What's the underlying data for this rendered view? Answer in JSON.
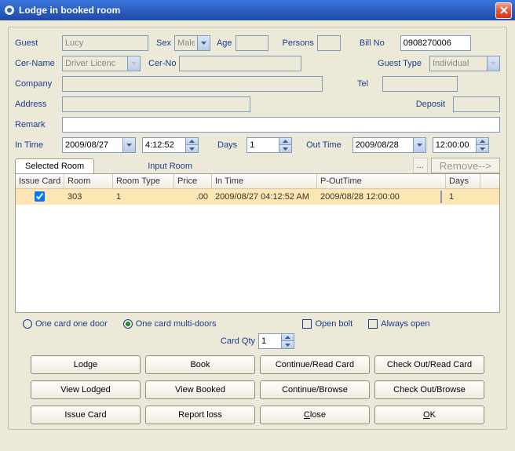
{
  "title": "Lodge in booked room",
  "labels": {
    "guest": "Guest",
    "sex": "Sex",
    "age": "Age",
    "persons": "Persons",
    "billno": "Bill No",
    "cername": "Cer-Name",
    "cerno": "Cer-No",
    "guesttype": "Guest Type",
    "company": "Company",
    "tel": "Tel",
    "address": "Address",
    "deposit": "Deposit",
    "remark": "Remark",
    "intime": "In Time",
    "days": "Days",
    "outtime": "Out Time"
  },
  "values": {
    "guest": "Lucy",
    "sex": "Male",
    "age": "",
    "persons": "",
    "billno": "0908270006",
    "cername": "Driver Licenc",
    "cerno": "",
    "guesttype": "Individual",
    "company": "",
    "tel": "",
    "address": "",
    "deposit": "",
    "remark": "",
    "in_date": "2009/08/27",
    "in_time": "4:12:52",
    "days": "1",
    "out_date": "2009/08/28",
    "out_time": "12:00:00",
    "card_qty": "1"
  },
  "tabs": {
    "selected": "Selected Room",
    "input": "Input Room",
    "remove": "Remove-->"
  },
  "grid": {
    "headers": [
      "Issue Card",
      "Room",
      "Room Type",
      "Price",
      "In Time",
      "P-OutTime",
      "Days"
    ],
    "rows": [
      {
        "checked": true,
        "room": "303",
        "type": "1",
        "price": ".00",
        "in": "2009/08/27 04:12:52 AM",
        "out": "2009/08/28 12:00:00",
        "days": "1"
      }
    ]
  },
  "options": {
    "one_door": "One card one door",
    "multi": "One card multi-doors",
    "open_bolt": "Open bolt",
    "always_open": "Always open",
    "card_qty_label": "Card Qty"
  },
  "buttons": {
    "lodge": "Lodge",
    "book": "Book",
    "cont_read": "Continue/Read Card",
    "checkout_read": "Check Out/Read Card",
    "view_lodged": "View Lodged",
    "view_booked": "View Booked",
    "cont_browse": "Continue/Browse",
    "checkout_browse": "Check Out/Browse",
    "issue_card": "Issue Card",
    "report_loss": "Report loss",
    "close": "Close",
    "ok": "OK"
  }
}
